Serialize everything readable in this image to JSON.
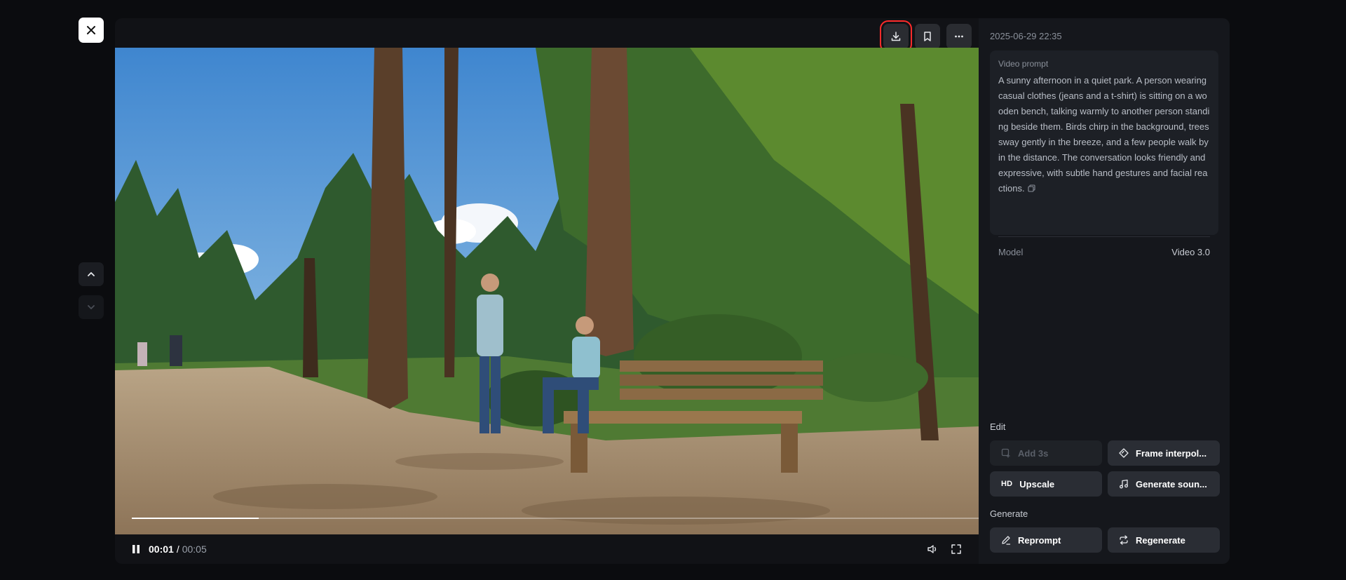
{
  "video": {
    "current_time": "00:01",
    "separator": "/",
    "total_time": "00:05",
    "progress_fraction": 0.15
  },
  "side": {
    "date": "2025-06-29 22:35",
    "prompt_label": "Video prompt",
    "prompt_text": "A sunny afternoon in a quiet park. A person wearing casual clothes (jeans and a t-shirt) is sitting on a wooden bench, talking warmly to another person standing beside them. Birds chirp in the background, trees sway gently in the breeze, and a few people walk by in the distance. The conversation looks friendly and expressive, with subtle hand gestures and facial reactions.",
    "model_label": "Model",
    "model_value": "Video 3.0",
    "edit_title": "Edit",
    "edit_buttons": {
      "add": "Add 3s",
      "frame": "Frame interpol...",
      "upscale_badge": "HD",
      "upscale": "Upscale",
      "sound": "Generate soun..."
    },
    "generate_title": "Generate",
    "generate_buttons": {
      "reprompt": "Reprompt",
      "regenerate": "Regenerate"
    }
  },
  "colors": {
    "background": "#0b0c0f",
    "panel": "#15171c",
    "button": "#2a2d34",
    "highlight": "#ff2b2b"
  }
}
